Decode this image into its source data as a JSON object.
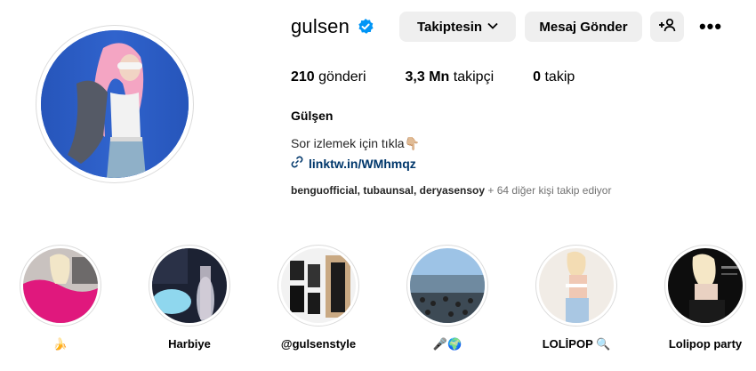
{
  "profile": {
    "username": "gulsen",
    "verified": true,
    "follow_button": "Takiptesin",
    "message_button": "Mesaj Gönder",
    "add_user_icon": "add-user-icon",
    "more_icon": "more-icon",
    "more_glyph": "•••",
    "full_name": "Gülşen",
    "bio": "Sor izlemek için tıkla👇🏼",
    "link": "linktw.in/WMhmqz",
    "followed_by_names": "benguofficial, tubaunsal, deryasensoy",
    "followed_by_more": " + 64 diğer kişi takip ediyor"
  },
  "stats": {
    "posts_value": "210",
    "posts_label": " gönderi",
    "followers_value": "3,3 Mn",
    "followers_label": " takipçi",
    "following_value": "0",
    "following_label": " takip"
  },
  "highlights": [
    {
      "label": "🍌"
    },
    {
      "label": "Harbiye"
    },
    {
      "label": "@gulsenstyle"
    },
    {
      "label": "🎤🌍"
    },
    {
      "label": "LOLİPOP 🔍"
    },
    {
      "label": "Lolipop party"
    }
  ],
  "colors": {
    "button_bg": "#efefef",
    "link": "#00376b",
    "verified_blue": "#0095f6",
    "muted": "#737373"
  }
}
